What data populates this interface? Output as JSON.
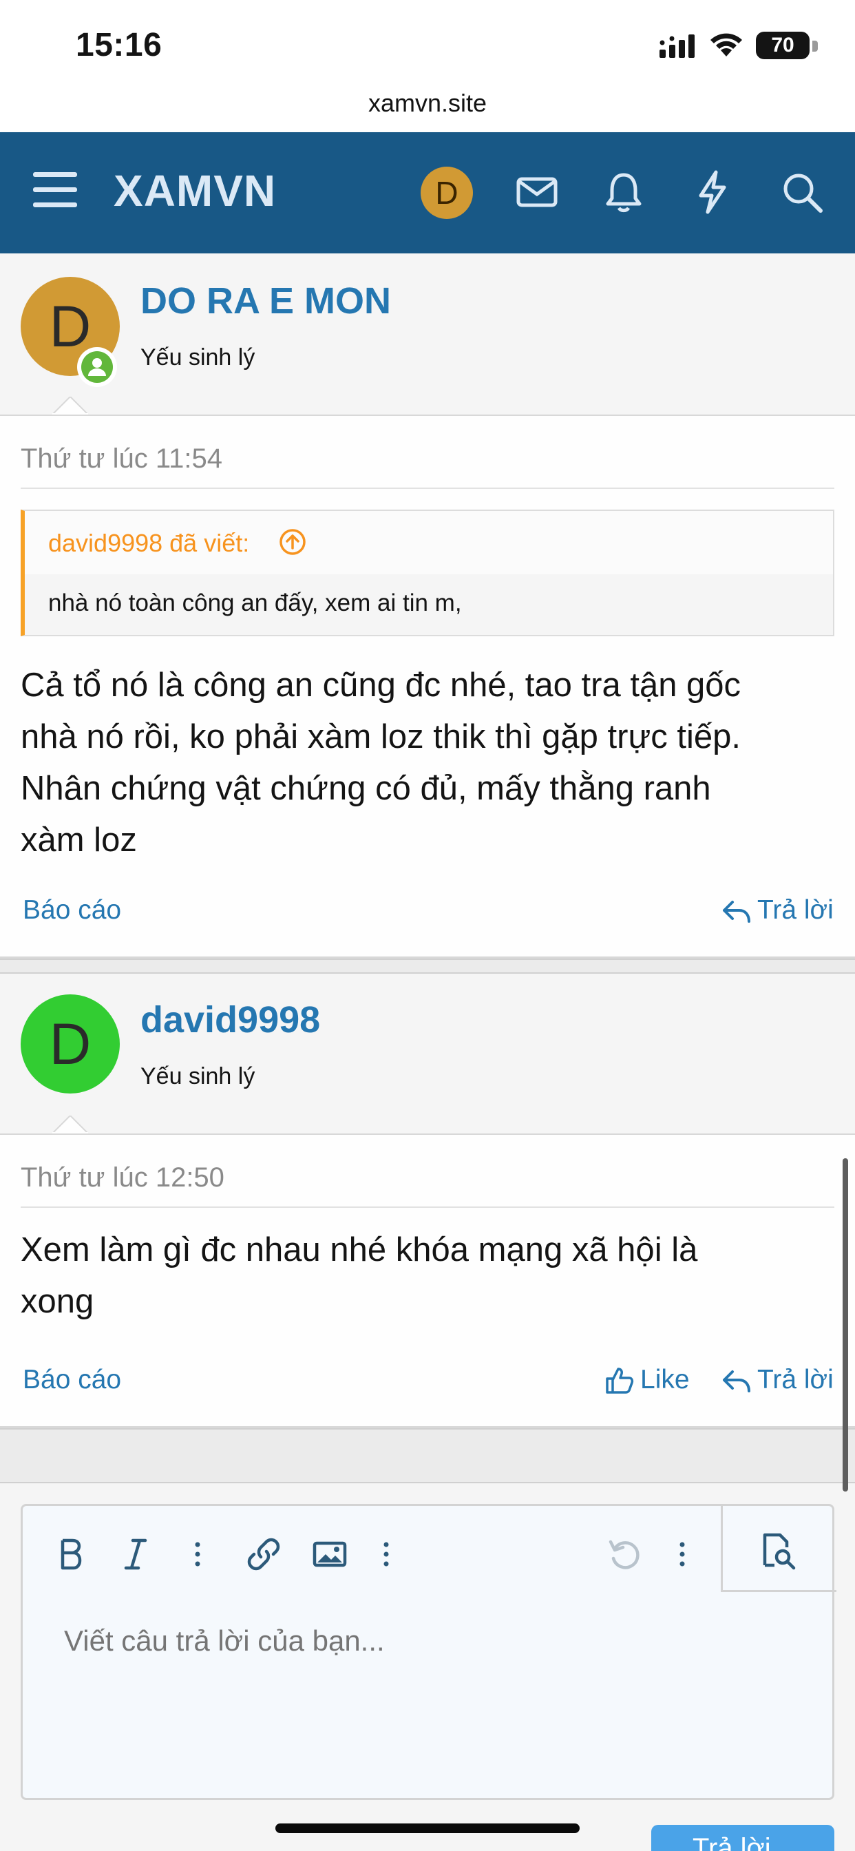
{
  "status_bar": {
    "time": "15:16",
    "battery": "70"
  },
  "browser": {
    "url": "xamvn.site"
  },
  "nav": {
    "logo": "XAMVN",
    "avatar_letter": "D"
  },
  "posts": [
    {
      "avatar_letter": "D",
      "avatar_color": "#d19a34",
      "username": "DO RA E MON",
      "user_title": "Yếu sinh lý",
      "date": "Thứ tư lúc 11:54",
      "quote": {
        "author": "david9998 đã viết:",
        "text": "nhà nó toàn công an đấy, xem ai tin m,"
      },
      "message_lines": [
        "Cả tổ nó là công an cũng đc nhé, tao tra tận gốc",
        "nhà nó rồi, ko phải xàm loz thik thì gặp trực tiếp.",
        "Nhân chứng vật chứng có đủ, mấy thằng ranh",
        "xàm loz"
      ],
      "report_label": "Báo cáo",
      "reply_label": "Trả lời"
    },
    {
      "avatar_letter": "D",
      "avatar_color": "#32cd32",
      "username": "david9998",
      "user_title": "Yếu sinh lý",
      "date": "Thứ tư lúc 12:50",
      "message_lines": [
        "Xem làm gì đc nhau nhé khóa mạng xã hội là",
        "xong"
      ],
      "report_label": "Báo cáo",
      "like_label": "Like",
      "reply_label": "Trả lời"
    }
  ],
  "editor": {
    "placeholder": "Viết câu trả lời của bạn...",
    "toolbar": [
      "bold-icon",
      "italic-icon",
      "more-icon",
      "link-icon",
      "image-icon",
      "more-icon",
      "undo-icon",
      "more-icon",
      "preview-icon"
    ]
  },
  "submit_label": "Trả lời",
  "colors": {
    "nav": "#185886",
    "link": "#2577b1",
    "quote_accent": "#f7a227"
  }
}
